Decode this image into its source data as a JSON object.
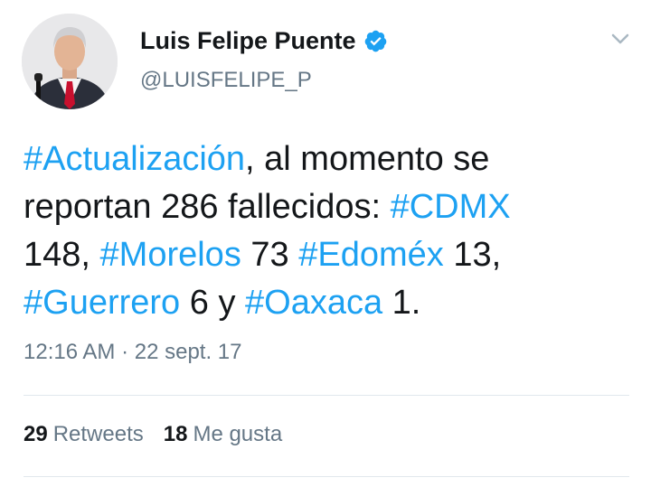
{
  "author": {
    "display_name": "Luis Felipe Puente",
    "handle": "@LUISFELIPE_P",
    "verified": true,
    "verified_color": "#1da1f2"
  },
  "tweet": {
    "line1": {
      "tag": "#Actualización",
      "text": ", al momento se"
    },
    "line2": {
      "text": "reportan 286 fallecidos: ",
      "tag": "#CDMX"
    },
    "line3": {
      "text1": "148, ",
      "tag1": "#Morelos",
      "text2": " 73 ",
      "tag2": "#Edoméx",
      "text3": " 13,"
    },
    "line4": {
      "tag1": "#Guerrero",
      "text1": " 6 y ",
      "tag2": "#Oaxaca",
      "text2": " 1."
    },
    "hashtag_color": "#1da1f2"
  },
  "timestamp": "12:16 AM · 22 sept. 17",
  "stats": {
    "retweets_count": "29",
    "retweets_label": "Retweets",
    "likes_count": "18",
    "likes_label": "Me gusta"
  },
  "icons": {
    "verified": "verified-badge-icon",
    "menu": "chevron-down-icon"
  }
}
